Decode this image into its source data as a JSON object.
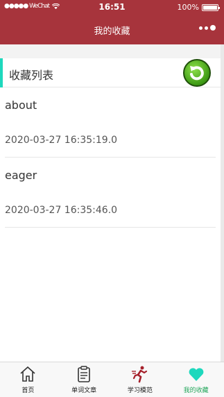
{
  "status_bar": {
    "carrier": "●●●●● WeChat",
    "time": "16:51",
    "battery": "100%"
  },
  "nav": {
    "title": "我的收藏"
  },
  "list": {
    "header": "收藏列表",
    "items": [
      {
        "word": "about",
        "time": "2020-03-27 16:35:19.0"
      },
      {
        "word": "eager",
        "time": "2020-03-27 16:35:46.0"
      }
    ]
  },
  "tabbar": {
    "tabs": [
      {
        "label": "首页",
        "icon": "home-icon"
      },
      {
        "label": "单词文章",
        "icon": "clipboard-icon"
      },
      {
        "label": "学习模范",
        "icon": "runner-icon"
      },
      {
        "label": "我的收藏",
        "icon": "heart-icon"
      }
    ],
    "active_index": 3
  },
  "colors": {
    "nav_bg": "#a7343c",
    "accent": "#1ed8bd",
    "active_tab": "#23a65b"
  }
}
